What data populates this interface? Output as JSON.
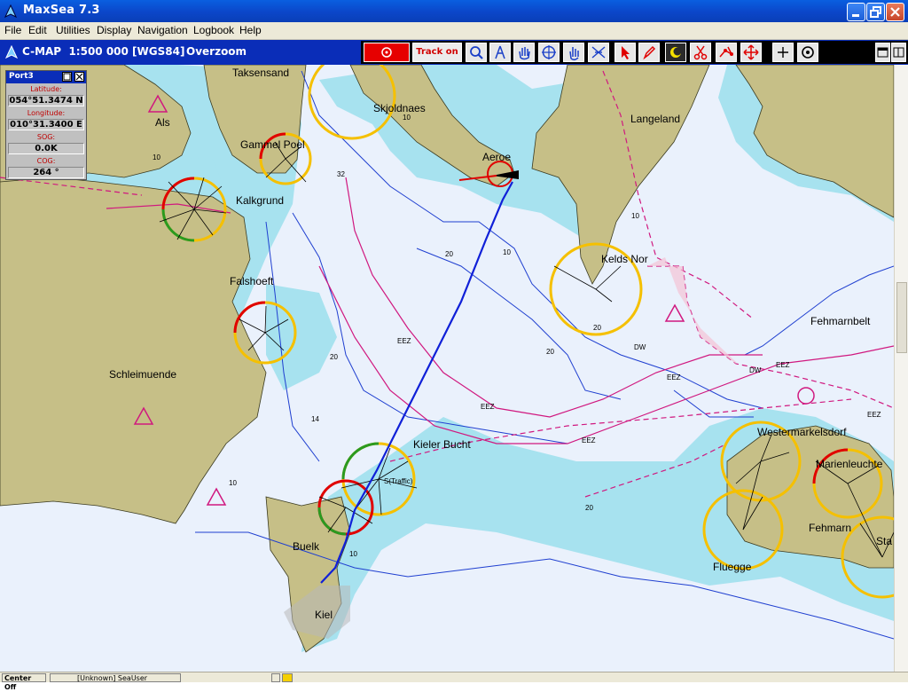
{
  "window": {
    "title": "MaxSea 7.3"
  },
  "menu": {
    "items": [
      "File",
      "Edit",
      "Utilities",
      "Display",
      "Navigation",
      "Logbook",
      "Help"
    ]
  },
  "chart": {
    "title": "C-MAP  1:500 000 [WGS84]",
    "mode": "Overzoom"
  },
  "toolbar": {
    "track_label": "Track on"
  },
  "info_panel": {
    "title": "Port3",
    "latitude_label": "Latitude:",
    "latitude": "054°51.3474 N",
    "longitude_label": "Longitude:",
    "longitude": "010°31.3400 E",
    "sog_label": "SOG:",
    "sog": "0.0K",
    "cog_label": "COG:",
    "cog": "264 °"
  },
  "places": {
    "taksensand": "Taksensand",
    "skjoldnaes": "Skjoldnaes",
    "als": "Als",
    "langeland": "Langeland",
    "gammel_poel": "Gammel Poel",
    "aeroe": "Aeroe",
    "kalkgrund": "Kalkgrund",
    "kelds_nor": "Kelds Nor",
    "falshoeft": "Falshoeft",
    "fehmarnbelt": "Fehmarnbelt",
    "schleimuende": "Schleimuende",
    "westermarkelsdorf": "Westermarkelsdorf",
    "kieler_bucht": "Kieler Bucht",
    "marienleuchte": "Marienleuchte",
    "traffic": "S(Traffic)",
    "buelk": "Buelk",
    "fehmarn": "Fehmarn",
    "sta": "Sta",
    "fluegge": "Fluegge",
    "kiel": "Kiel"
  },
  "depths": {
    "d10": "10",
    "d20": "20",
    "d32": "32",
    "d14": "14",
    "eez": "EEZ",
    "dw": "DW"
  },
  "status": {
    "center": "Center Off",
    "user": "[Unknown] SeaUser"
  },
  "colors": {
    "land": "#c6bf87",
    "shallow": "#a7e2ef",
    "deep": "#eaf1fc",
    "route": "#d0187f",
    "track": "#1020d8",
    "light_yellow": "#f5c000"
  }
}
